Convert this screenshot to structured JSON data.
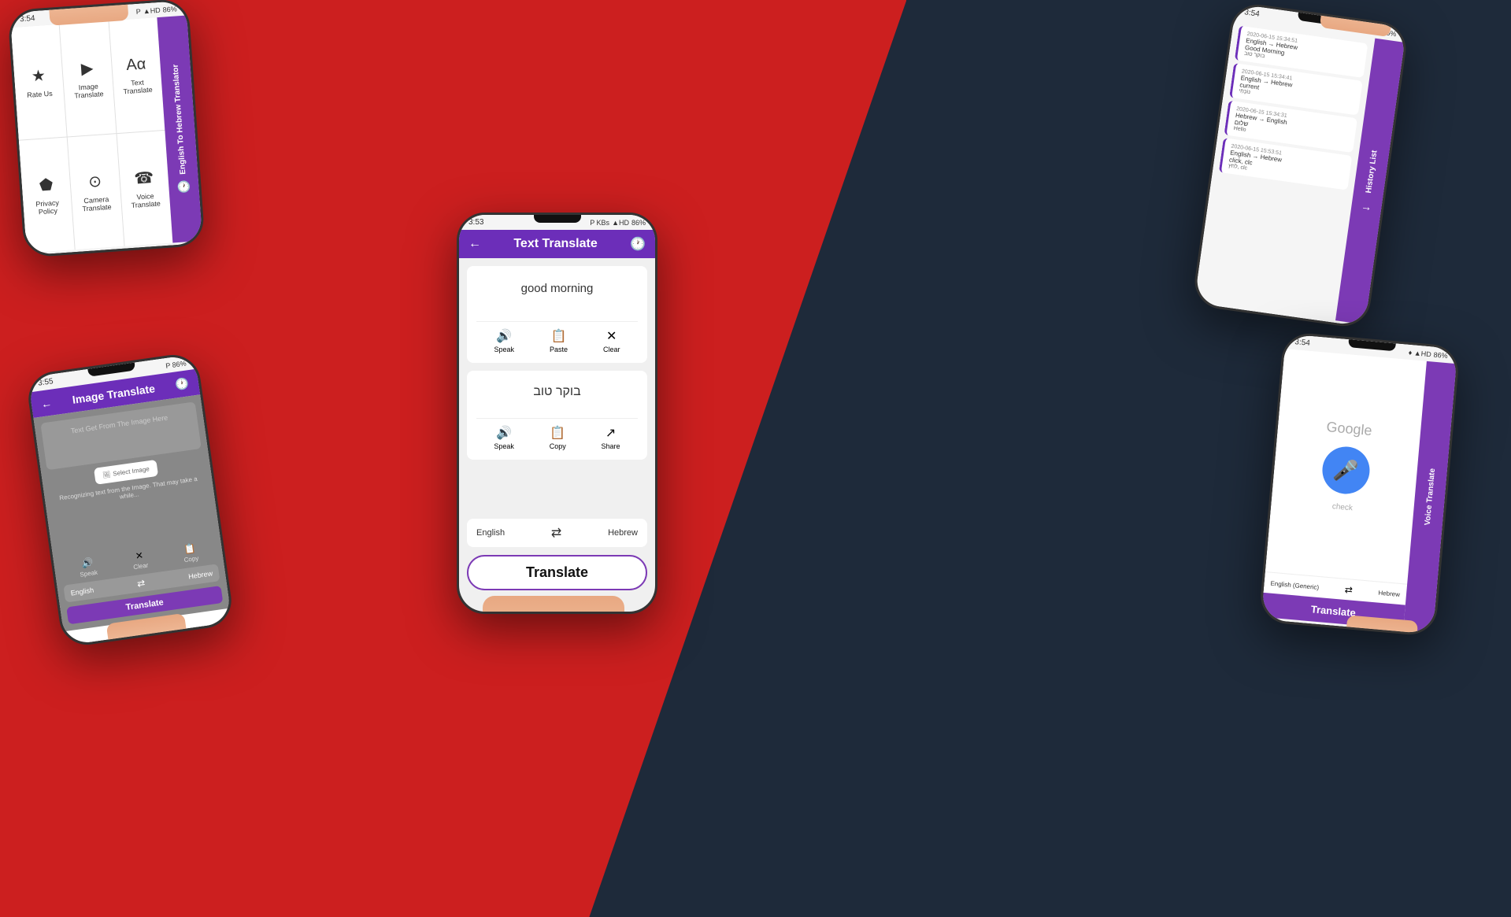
{
  "background": {
    "left_color": "#cc1f1f",
    "right_color": "#1e2a3a"
  },
  "phones": {
    "center": {
      "title": "Text Translate",
      "status_time": "3:53",
      "status_battery": "86%",
      "input_text": "good morning",
      "output_text": "בוקר טוב",
      "source_lang": "English",
      "target_lang": "Hebrew",
      "translate_btn": "Translate",
      "actions_input": {
        "speak": "Speak",
        "paste": "Paste",
        "clear": "Clear"
      },
      "actions_output": {
        "speak": "Speak",
        "copy": "Copy",
        "share": "Share"
      }
    },
    "top_left": {
      "title": "English To Hebrew Translator",
      "status_time": "3:54",
      "menu_items": [
        {
          "label": "Rate Us",
          "icon": "★"
        },
        {
          "label": "Image Translate",
          "icon": "▶"
        },
        {
          "label": "Text Translate",
          "icon": "🔤"
        },
        {
          "label": "Privacy Policy",
          "icon": "⬟"
        },
        {
          "label": "Camera Translate",
          "icon": "⊙"
        },
        {
          "label": "Voice Translate",
          "icon": "☎"
        }
      ]
    },
    "bottom_left": {
      "title": "Image Translate",
      "status_time": "3:55",
      "placeholder": "Text Get From The Image Here",
      "select_image": "Select Image",
      "note": "Recognizing text from the Image. That may take a while...",
      "clear_label": "Clear",
      "speak_label": "Speak",
      "copy_label": "Copy",
      "source_lang": "English",
      "target_lang": "Hebrew",
      "translate_label": "Translate"
    },
    "top_right": {
      "title": "History List",
      "status_time": "3:54",
      "history_items": [
        {
          "date": "2020-06-15 15:34:51",
          "from": "English",
          "to": "Hebrew",
          "source": "Good Morning",
          "translation": "בוקר טוב"
        },
        {
          "date": "2020-06-15 15:34:41",
          "from": "English",
          "to": "Hebrew",
          "source": "current",
          "translation": "נוֹכְחִי"
        },
        {
          "date": "2020-06-15 15:34:31",
          "from": "Hebrew",
          "to": "English",
          "source": "שלום",
          "translation": "Hello"
        },
        {
          "date": "2020-06-15 15:53:51",
          "from": "English",
          "to": "Hebrew",
          "source": "click, clc",
          "translation": "לחץ, clc"
        }
      ]
    },
    "bottom_right": {
      "title": "Voice Translate",
      "status_time": "3:54",
      "status_battery": "86%",
      "google_label": "Google",
      "mic_icon": "🎤",
      "check_label": "check",
      "source_lang": "English (Generic)",
      "target_lang": "Hebrew",
      "translate_label": "Translate"
    }
  }
}
